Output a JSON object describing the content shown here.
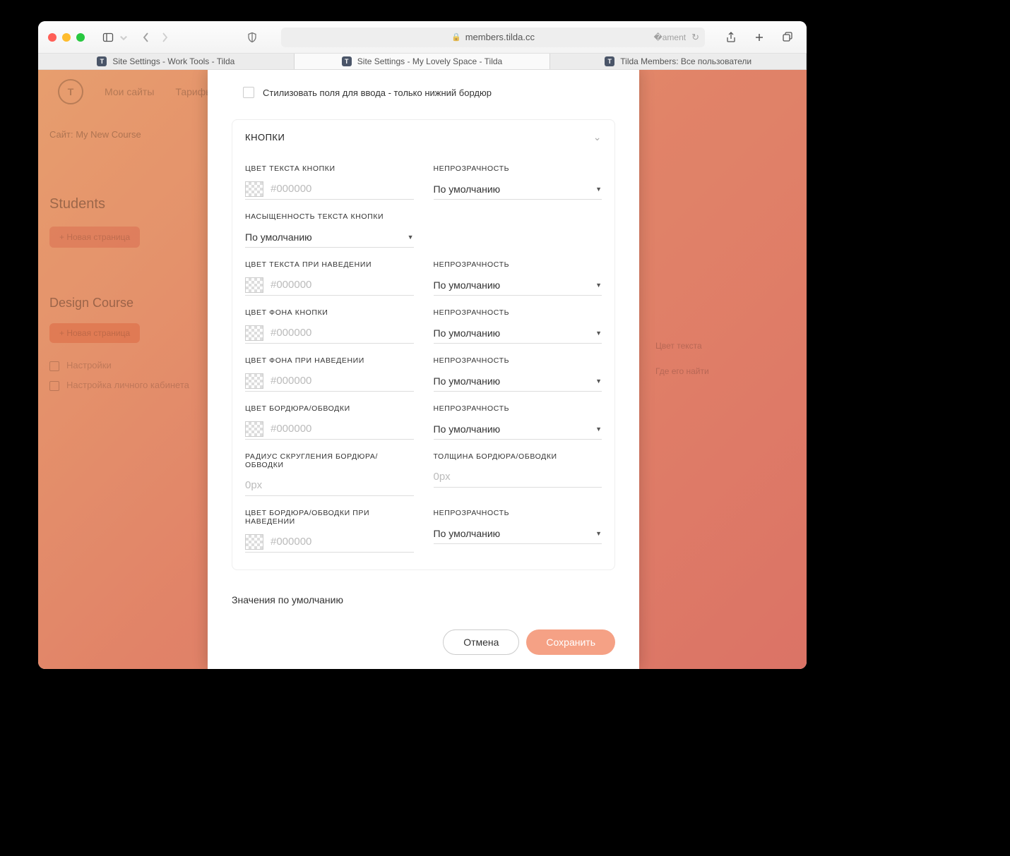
{
  "url": "members.tilda.cc",
  "tabs": [
    {
      "label": "Site Settings - Work Tools - Tilda"
    },
    {
      "label": "Site Settings - My Lovely Space - Tilda"
    },
    {
      "label": "Tilda Members: Все пользователи"
    }
  ],
  "bg": {
    "crumb": "Сайт: My New Course",
    "nav1": "Мои сайты",
    "nav2": "Тарифы и",
    "hd1": "Students",
    "pill1": "+ Новая страница",
    "hd2": "Design Course",
    "pill2": "+ Новая страница",
    "item1": "Настройки",
    "item2": "Настройка личного кабинета",
    "r1": "Цвет текста",
    "r2": "Где его найти"
  },
  "checkbox_label": "Стилизовать поля для ввода - только нижний бордюр",
  "panel_title": "КНОПКИ",
  "labels": {
    "text_color": "ЦВЕТ ТЕКСТА КНОПКИ",
    "opacity": "НЕПРОЗРАЧНОСТЬ",
    "text_weight": "НАСЫЩЕННОСТЬ ТЕКСТА КНОПКИ",
    "text_hover": "ЦВЕТ ТЕКСТА ПРИ НАВЕДЕНИИ",
    "bg_color": "ЦВЕТ ФОНА КНОПКИ",
    "bg_hover": "ЦВЕТ ФОНА ПРИ НАВЕДЕНИИ",
    "border_color": "ЦВЕТ БОРДЮРА/ОБВОДКИ",
    "border_radius": "РАДИУС СКРУГЛЕНИЯ БОРДЮРА/ОБВОДКИ",
    "border_width": "ТОЛЩИНА БОРДЮРА/ОБВОДКИ",
    "border_hover": "ЦВЕТ БОРДЮРА/ОБВОДКИ ПРИ НАВЕДЕНИИ"
  },
  "placeholder_color": "#000000",
  "placeholder_px": "0px",
  "select_default": "По умолчанию",
  "defaults_text": "Значения по умолчанию",
  "cancel": "Отмена",
  "save": "Сохранить"
}
